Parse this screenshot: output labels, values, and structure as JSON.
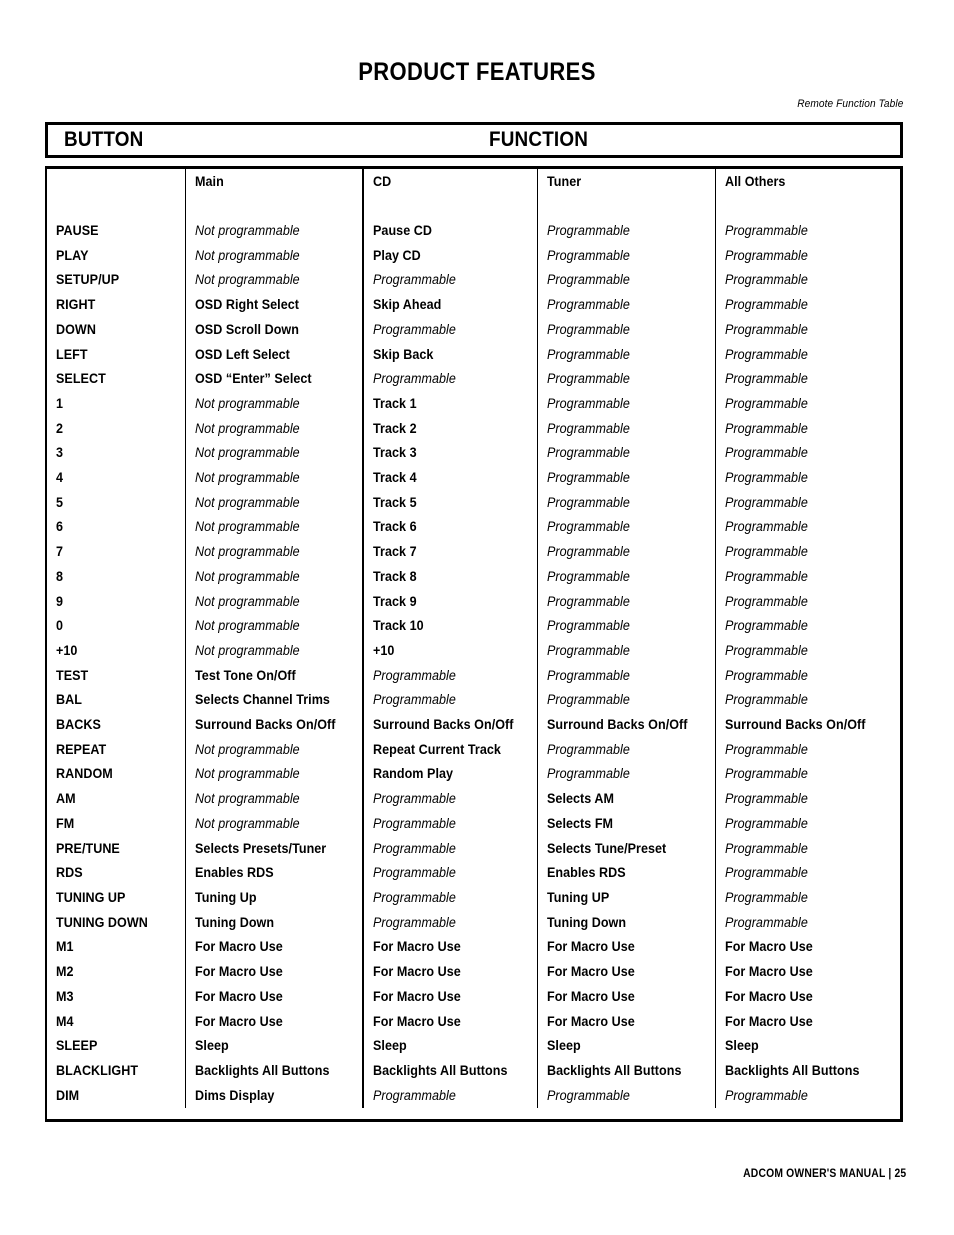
{
  "page": {
    "title": "PRODUCT FEATURES",
    "caption": "Remote Function Table",
    "footer": "ADCOM OWNER'S MANUAL | 25"
  },
  "headbar": {
    "button_label": "BUTTON",
    "function_label": "FUNCTION"
  },
  "table": {
    "columns": [
      {
        "key": "button",
        "label": ""
      },
      {
        "key": "main",
        "label": "Main"
      },
      {
        "key": "cd",
        "label": "CD"
      },
      {
        "key": "tuner",
        "label": "Tuner"
      },
      {
        "key": "other",
        "label": "All Others"
      }
    ],
    "rows": [
      {
        "button": "PAUSE",
        "main": {
          "text": "Not programmable",
          "style": "italic"
        },
        "cd": {
          "text": "Pause CD",
          "style": "bold"
        },
        "tuner": {
          "text": "Programmable",
          "style": "italic"
        },
        "other": {
          "text": "Programmable",
          "style": "italic"
        }
      },
      {
        "button": "PLAY",
        "main": {
          "text": "Not programmable",
          "style": "italic"
        },
        "cd": {
          "text": "Play CD",
          "style": "bold"
        },
        "tuner": {
          "text": "Programmable",
          "style": "italic"
        },
        "other": {
          "text": "Programmable",
          "style": "italic"
        }
      },
      {
        "button": "SETUP/UP",
        "main": {
          "text": "Not programmable",
          "style": "italic"
        },
        "cd": {
          "text": "Programmable",
          "style": "italic"
        },
        "tuner": {
          "text": "Programmable",
          "style": "italic"
        },
        "other": {
          "text": "Programmable",
          "style": "italic"
        }
      },
      {
        "button": "RIGHT",
        "main": {
          "text": "OSD Right Select",
          "style": "bold"
        },
        "cd": {
          "text": "Skip Ahead",
          "style": "bold"
        },
        "tuner": {
          "text": "Programmable",
          "style": "italic"
        },
        "other": {
          "text": "Programmable",
          "style": "italic"
        }
      },
      {
        "button": "DOWN",
        "main": {
          "text": "OSD Scroll Down",
          "style": "bold"
        },
        "cd": {
          "text": "Programmable",
          "style": "italic"
        },
        "tuner": {
          "text": "Programmable",
          "style": "italic"
        },
        "other": {
          "text": "Programmable",
          "style": "italic"
        }
      },
      {
        "button": "LEFT",
        "main": {
          "text": "OSD Left Select",
          "style": "bold"
        },
        "cd": {
          "text": "Skip Back",
          "style": "bold"
        },
        "tuner": {
          "text": "Programmable",
          "style": "italic"
        },
        "other": {
          "text": "Programmable",
          "style": "italic"
        }
      },
      {
        "button": "SELECT",
        "main": {
          "text": "OSD “Enter” Select",
          "style": "bold"
        },
        "cd": {
          "text": "Programmable",
          "style": "italic"
        },
        "tuner": {
          "text": "Programmable",
          "style": "italic"
        },
        "other": {
          "text": "Programmable",
          "style": "italic"
        }
      },
      {
        "button": "1",
        "main": {
          "text": "Not programmable",
          "style": "italic"
        },
        "cd": {
          "text": "Track 1",
          "style": "bold"
        },
        "tuner": {
          "text": "Programmable",
          "style": "italic"
        },
        "other": {
          "text": "Programmable",
          "style": "italic"
        }
      },
      {
        "button": "2",
        "main": {
          "text": "Not programmable",
          "style": "italic"
        },
        "cd": {
          "text": "Track 2",
          "style": "bold"
        },
        "tuner": {
          "text": "Programmable",
          "style": "italic"
        },
        "other": {
          "text": "Programmable",
          "style": "italic"
        }
      },
      {
        "button": "3",
        "main": {
          "text": "Not programmable",
          "style": "italic"
        },
        "cd": {
          "text": "Track 3",
          "style": "bold"
        },
        "tuner": {
          "text": "Programmable",
          "style": "italic"
        },
        "other": {
          "text": "Programmable",
          "style": "italic"
        }
      },
      {
        "button": "4",
        "main": {
          "text": "Not programmable",
          "style": "italic"
        },
        "cd": {
          "text": "Track 4",
          "style": "bold"
        },
        "tuner": {
          "text": "Programmable",
          "style": "italic"
        },
        "other": {
          "text": "Programmable",
          "style": "italic"
        }
      },
      {
        "button": "5",
        "main": {
          "text": "Not programmable",
          "style": "italic"
        },
        "cd": {
          "text": "Track 5",
          "style": "bold"
        },
        "tuner": {
          "text": "Programmable",
          "style": "italic"
        },
        "other": {
          "text": "Programmable",
          "style": "italic"
        }
      },
      {
        "button": "6",
        "main": {
          "text": "Not programmable",
          "style": "italic"
        },
        "cd": {
          "text": "Track 6",
          "style": "bold"
        },
        "tuner": {
          "text": "Programmable",
          "style": "italic"
        },
        "other": {
          "text": "Programmable",
          "style": "italic"
        }
      },
      {
        "button": "7",
        "main": {
          "text": "Not programmable",
          "style": "italic"
        },
        "cd": {
          "text": "Track 7",
          "style": "bold"
        },
        "tuner": {
          "text": "Programmable",
          "style": "italic"
        },
        "other": {
          "text": "Programmable",
          "style": "italic"
        }
      },
      {
        "button": "8",
        "main": {
          "text": "Not programmable",
          "style": "italic"
        },
        "cd": {
          "text": "Track 8",
          "style": "bold"
        },
        "tuner": {
          "text": "Programmable",
          "style": "italic"
        },
        "other": {
          "text": "Programmable",
          "style": "italic"
        }
      },
      {
        "button": "9",
        "main": {
          "text": "Not programmable",
          "style": "italic"
        },
        "cd": {
          "text": "Track 9",
          "style": "bold"
        },
        "tuner": {
          "text": "Programmable",
          "style": "italic"
        },
        "other": {
          "text": "Programmable",
          "style": "italic"
        }
      },
      {
        "button": "0",
        "main": {
          "text": "Not programmable",
          "style": "italic"
        },
        "cd": {
          "text": "Track 10",
          "style": "bold"
        },
        "tuner": {
          "text": "Programmable",
          "style": "italic"
        },
        "other": {
          "text": "Programmable",
          "style": "italic"
        }
      },
      {
        "button": "+10",
        "main": {
          "text": "Not programmable",
          "style": "italic"
        },
        "cd": {
          "text": "+10",
          "style": "bold"
        },
        "tuner": {
          "text": "Programmable",
          "style": "italic"
        },
        "other": {
          "text": "Programmable",
          "style": "italic"
        }
      },
      {
        "button": "TEST",
        "main": {
          "text": "Test Tone On/Off",
          "style": "bold"
        },
        "cd": {
          "text": "Programmable",
          "style": "italic"
        },
        "tuner": {
          "text": "Programmable",
          "style": "italic"
        },
        "other": {
          "text": "Programmable",
          "style": "italic"
        }
      },
      {
        "button": "BAL",
        "main": {
          "text": "Selects Channel Trims",
          "style": "bold"
        },
        "cd": {
          "text": "Programmable",
          "style": "italic"
        },
        "tuner": {
          "text": "Programmable",
          "style": "italic"
        },
        "other": {
          "text": "Programmable",
          "style": "italic"
        }
      },
      {
        "button": "BACKS",
        "main": {
          "text": "Surround Backs On/Off",
          "style": "bold"
        },
        "cd": {
          "text": "Surround Backs On/Off",
          "style": "bold"
        },
        "tuner": {
          "text": "Surround Backs On/Off",
          "style": "bold"
        },
        "other": {
          "text": "Surround Backs On/Off",
          "style": "bold"
        }
      },
      {
        "button": "REPEAT",
        "main": {
          "text": "Not programmable",
          "style": "italic"
        },
        "cd": {
          "text": "Repeat Current Track",
          "style": "bold"
        },
        "tuner": {
          "text": "Programmable",
          "style": "italic"
        },
        "other": {
          "text": "Programmable",
          "style": "italic"
        }
      },
      {
        "button": "RANDOM",
        "main": {
          "text": "Not programmable",
          "style": "italic"
        },
        "cd": {
          "text": "Random Play",
          "style": "bold"
        },
        "tuner": {
          "text": "Programmable",
          "style": "italic"
        },
        "other": {
          "text": "Programmable",
          "style": "italic"
        }
      },
      {
        "button": "AM",
        "main": {
          "text": "Not programmable",
          "style": "italic"
        },
        "cd": {
          "text": "Programmable",
          "style": "italic"
        },
        "tuner": {
          "text": "Selects AM",
          "style": "bold"
        },
        "other": {
          "text": "Programmable",
          "style": "italic"
        }
      },
      {
        "button": "FM",
        "main": {
          "text": "Not programmable",
          "style": "italic"
        },
        "cd": {
          "text": "Programmable",
          "style": "italic"
        },
        "tuner": {
          "text": "Selects FM",
          "style": "bold"
        },
        "other": {
          "text": "Programmable",
          "style": "italic"
        }
      },
      {
        "button": "PRE/TUNE",
        "main": {
          "text": "Selects Presets/Tuner",
          "style": "bold"
        },
        "cd": {
          "text": "Programmable",
          "style": "italic"
        },
        "tuner": {
          "text": "Selects Tune/Preset",
          "style": "bold"
        },
        "other": {
          "text": "Programmable",
          "style": "italic"
        }
      },
      {
        "button": "RDS",
        "main": {
          "text": "Enables RDS",
          "style": "bold"
        },
        "cd": {
          "text": "Programmable",
          "style": "italic"
        },
        "tuner": {
          "text": "Enables RDS",
          "style": "bold"
        },
        "other": {
          "text": "Programmable",
          "style": "italic"
        }
      },
      {
        "button": "TUNING UP",
        "main": {
          "text": "Tuning Up",
          "style": "bold"
        },
        "cd": {
          "text": "Programmable",
          "style": "italic"
        },
        "tuner": {
          "text": "Tuning UP",
          "style": "bold"
        },
        "other": {
          "text": "Programmable",
          "style": "italic"
        }
      },
      {
        "button": "TUNING DOWN",
        "main": {
          "text": "Tuning Down",
          "style": "bold"
        },
        "cd": {
          "text": "Programmable",
          "style": "italic"
        },
        "tuner": {
          "text": "Tuning Down",
          "style": "bold"
        },
        "other": {
          "text": "Programmable",
          "style": "italic"
        }
      },
      {
        "button": "M1",
        "main": {
          "text": "For Macro Use",
          "style": "bold"
        },
        "cd": {
          "text": "For Macro Use",
          "style": "bold"
        },
        "tuner": {
          "text": "For Macro Use",
          "style": "bold"
        },
        "other": {
          "text": "For Macro Use",
          "style": "bold"
        }
      },
      {
        "button": "M2",
        "main": {
          "text": "For Macro Use",
          "style": "bold"
        },
        "cd": {
          "text": "For Macro Use",
          "style": "bold"
        },
        "tuner": {
          "text": "For Macro Use",
          "style": "bold"
        },
        "other": {
          "text": "For Macro Use",
          "style": "bold"
        }
      },
      {
        "button": "M3",
        "main": {
          "text": "For Macro Use",
          "style": "bold"
        },
        "cd": {
          "text": "For Macro Use",
          "style": "bold"
        },
        "tuner": {
          "text": "For Macro Use",
          "style": "bold"
        },
        "other": {
          "text": "For Macro Use",
          "style": "bold"
        }
      },
      {
        "button": "M4",
        "main": {
          "text": "For Macro Use",
          "style": "bold"
        },
        "cd": {
          "text": "For Macro Use",
          "style": "bold"
        },
        "tuner": {
          "text": "For Macro Use",
          "style": "bold"
        },
        "other": {
          "text": "For Macro Use",
          "style": "bold"
        }
      },
      {
        "button": "SLEEP",
        "main": {
          "text": "Sleep",
          "style": "bold"
        },
        "cd": {
          "text": "Sleep",
          "style": "bold"
        },
        "tuner": {
          "text": "Sleep",
          "style": "bold"
        },
        "other": {
          "text": "Sleep",
          "style": "bold"
        }
      },
      {
        "button": "BLACKLIGHT",
        "main": {
          "text": "Backlights All Buttons",
          "style": "bold"
        },
        "cd": {
          "text": "Backlights All Buttons",
          "style": "bold"
        },
        "tuner": {
          "text": "Backlights All Buttons",
          "style": "bold"
        },
        "other": {
          "text": "Backlights All Buttons",
          "style": "bold"
        }
      },
      {
        "button": "DIM",
        "main": {
          "text": "Dims Display",
          "style": "bold"
        },
        "cd": {
          "text": "Programmable",
          "style": "italic"
        },
        "tuner": {
          "text": "Programmable",
          "style": "italic"
        },
        "other": {
          "text": "Programmable",
          "style": "italic"
        }
      }
    ]
  }
}
